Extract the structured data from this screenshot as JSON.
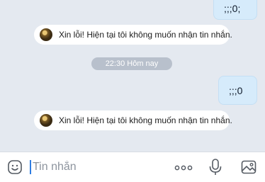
{
  "messages": {
    "outgoing_top": ";;;0;",
    "system_notice_1": "Xin lỗi! Hiện tại tôi không muốn nhận tin nhắn.",
    "time_divider": "22:30 Hôm nay",
    "outgoing_mid": ";;;0",
    "system_notice_2": "Xin lỗi! Hiện tại tôi không muốn nhận tin nhắn."
  },
  "composer": {
    "placeholder": "Tin nhắn",
    "icons": [
      "emoji-icon",
      "more-icon",
      "microphone-icon",
      "image-icon"
    ]
  },
  "colors": {
    "background": "#e4e9f0",
    "outgoing_bubble": "#d6ebfb",
    "time_pill": "#b8c0cc",
    "caret": "#2f7de1"
  }
}
